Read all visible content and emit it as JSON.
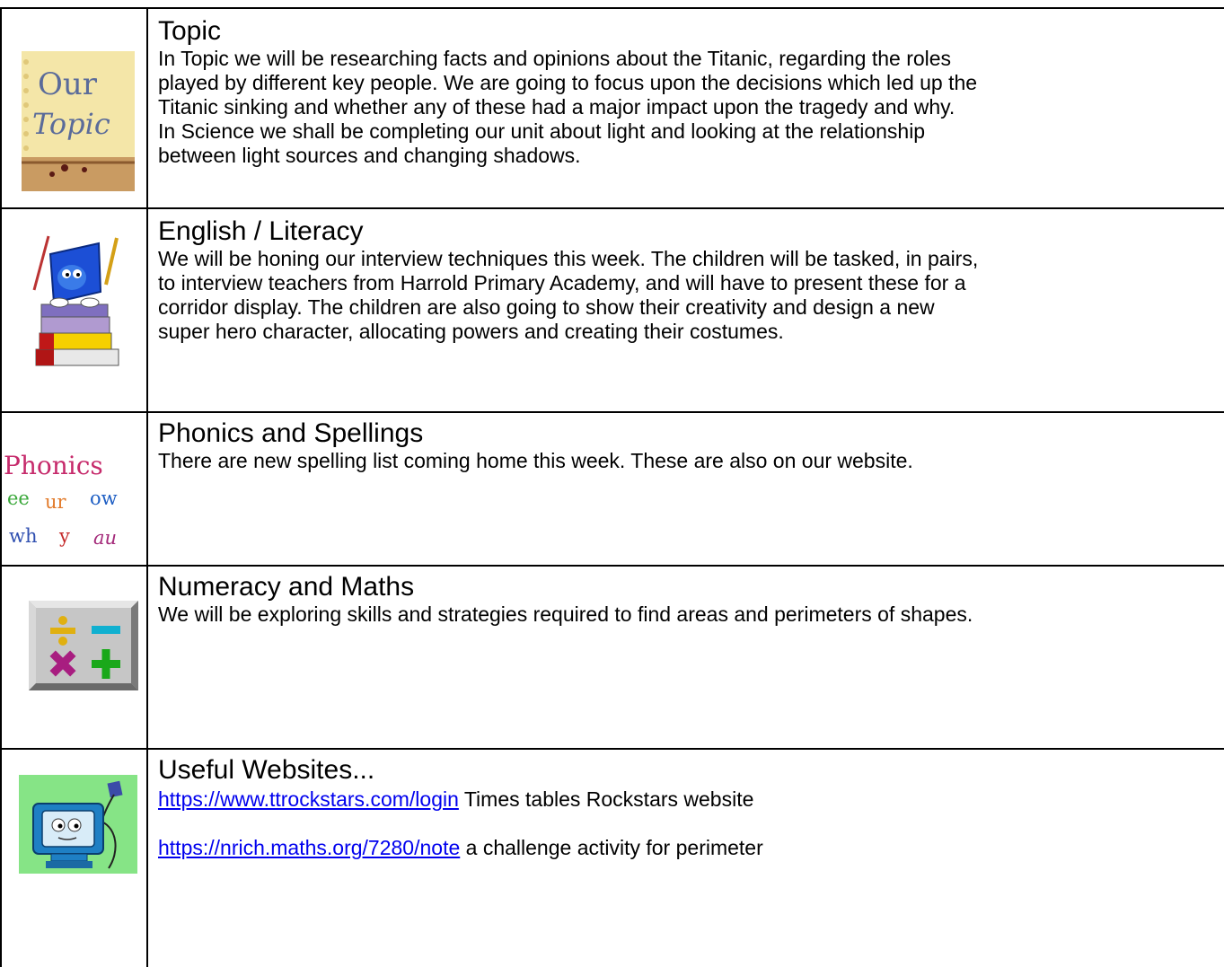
{
  "sections": [
    {
      "heading": "Topic",
      "icon": "our-topic-notepad-icon",
      "icon_text": [
        "Our",
        "Topic"
      ],
      "body": [
        "In Topic we will be researching facts and opinions about the Titanic, regarding the roles",
        "played by different key people.  We are going to focus upon the decisions which led up the",
        "Titanic sinking and whether any of these had a major impact upon the tragedy and why.",
        "In Science we shall be completing our unit about light and looking at the relationship",
        "between light sources and changing shadows."
      ]
    },
    {
      "heading": "English / Literacy",
      "icon": "bookworm-on-books-icon",
      "body": [
        "We will be honing our interview techniques this week.  The children will be tasked, in pairs,",
        "to interview teachers from Harrold Primary Academy, and will have to present these for a",
        "corridor display.  The children are also going to show their creativity and design a new",
        "super hero character, allocating powers and creating their costumes."
      ]
    },
    {
      "heading": "Phonics and Spellings",
      "icon": "phonics-letters-icon",
      "icon_text": {
        "word": "Phonics",
        "row1": [
          "ee",
          "ur",
          "ow"
        ],
        "row2": [
          "wh",
          "y",
          "au"
        ]
      },
      "body": [
        "There are new spelling list coming home this week.  These are also on our website."
      ]
    },
    {
      "heading": "Numeracy and Maths",
      "icon": "math-operators-icon",
      "body": [
        "We will be exploring skills and strategies required to find areas and perimeters of shapes."
      ]
    },
    {
      "heading": "Useful Websites...",
      "icon": "computer-monitor-icon",
      "links": [
        {
          "url": "https://www.ttrockstars.com/login",
          "text": " Times tables Rockstars website"
        },
        {
          "url": "https://nrich.maths.org/7280/note",
          "text": " a challenge activity for perimeter"
        }
      ]
    }
  ],
  "colors": {
    "link": "#0000ee",
    "border": "#000000"
  }
}
